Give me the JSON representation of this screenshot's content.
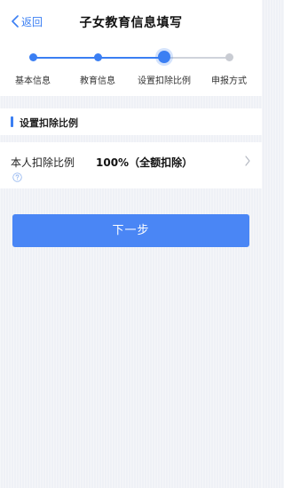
{
  "header": {
    "back_label": "返回",
    "title": "子女教育信息填写"
  },
  "stepper": {
    "steps": [
      {
        "label": "基本信息",
        "state": "done"
      },
      {
        "label": "教育信息",
        "state": "done"
      },
      {
        "label": "设置扣除比例",
        "state": "current"
      },
      {
        "label": "申报方式",
        "state": "todo"
      }
    ]
  },
  "section": {
    "title": "设置扣除比例"
  },
  "deduction": {
    "label": "本人扣除比例",
    "value": "100%（全额扣除）"
  },
  "actions": {
    "next_label": "下一步"
  },
  "colors": {
    "accent": "#3b7ff3",
    "button": "#4a86f5",
    "background": "#eff1f6"
  },
  "icons": {
    "back": "chevron-left-icon",
    "help": "question-circle-icon",
    "row_arrow": "chevron-right-icon"
  }
}
